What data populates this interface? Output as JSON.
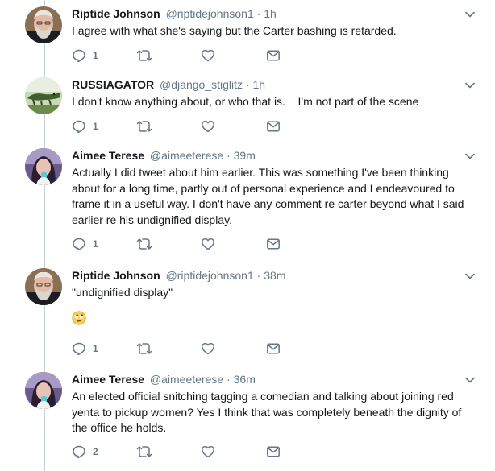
{
  "colors": {
    "text": "#14171a",
    "muted": "#657786",
    "thread_line": "#c4cfd6"
  },
  "tweets": [
    {
      "name": "Riptide Johnson",
      "handle": "@riptidejohnson1",
      "time": "1h",
      "dot": "·",
      "text": "I agree with what she's saying but the Carter bashing is retarded.",
      "reply_count": "1",
      "avatar": "bearded-man-avatar"
    },
    {
      "name": "RUSSIAGATOR",
      "handle": "@django_stiglitz",
      "time": "1h",
      "dot": "·",
      "text": "I don't know anything about, or who that is.    I'm not part of the scene",
      "reply_count": "1",
      "avatar": "alligator-avatar"
    },
    {
      "name": "Aimee Terese",
      "handle": "@aimeeterese",
      "time": "39m",
      "dot": "·",
      "text": "Actually I did tweet about him earlier. This was something I've been thinking about for a long time, partly out of personal experience and I endeavoured to frame it in a useful way. I don't have any comment re carter beyond what I said earlier re his undignified display.",
      "reply_count": "1",
      "avatar": "woman-avatar"
    },
    {
      "name": "Riptide Johnson",
      "handle": "@riptidejohnson1",
      "time": "38m",
      "dot": "·",
      "text": "\"undignified display\"",
      "reply_count": "1",
      "avatar": "bearded-man-avatar",
      "emoji": "rolling-eyes-emoji"
    },
    {
      "name": "Aimee Terese",
      "handle": "@aimeeterese",
      "time": "36m",
      "dot": "·",
      "text": "An elected official snitching tagging a comedian and talking about joining red yenta to pickup women? Yes I think that was completely beneath the dignity of the office he holds.",
      "reply_count": "2",
      "avatar": "woman-avatar"
    }
  ]
}
